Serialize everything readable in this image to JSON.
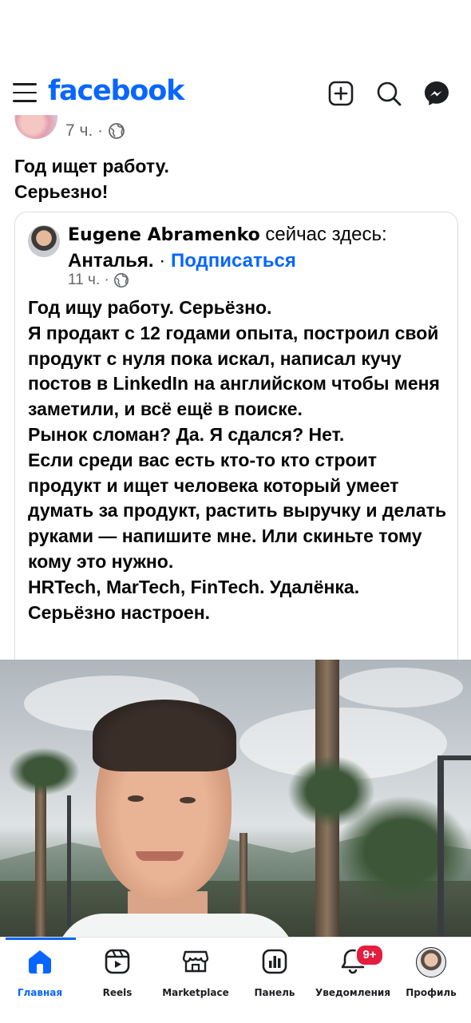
{
  "header": {
    "logo": "facebook",
    "icons": [
      "menu-icon",
      "add-icon",
      "search-icon",
      "messenger-icon"
    ],
    "brand_color": "#0866ff"
  },
  "post": {
    "time": "7 ч. ·",
    "text_lines": [
      "Год ищет работу.",
      "Серьезно!"
    ]
  },
  "shared": {
    "author": "Eugene Abramenko",
    "status_text": "сейчас здесь:",
    "place": "Анталья.",
    "separator": "·",
    "follow_label": "Подписаться",
    "time": "11 ч. ·",
    "paragraphs": [
      "Год ищу работу. Серьёзно.",
      "Я продакт с 12 годами опыта, построил свой продукт с нуля пока искал, написал кучу постов в LinkedIn на английском чтобы меня заметили, и всё ещё в поиске.",
      "Рынок сломан? Да. Я сдался? Нет.",
      "Если среди вас есть кто-то кто строит продукт и ищет человека который умеет думать за продукт, растить выручку и делать руками — напишите мне. Или скиньте тому кому это нужно.",
      "HRTech, MarTech, FinTech. Удалёнка.",
      "Серьёзно настроен."
    ]
  },
  "bottom_nav": {
    "items": [
      {
        "label": "Главная",
        "icon": "home-icon",
        "active": true
      },
      {
        "label": "Reels",
        "icon": "reels-icon"
      },
      {
        "label": "Marketplace",
        "icon": "marketplace-icon"
      },
      {
        "label": "Панель",
        "icon": "dashboard-icon"
      },
      {
        "label": "Уведомления",
        "icon": "bell-icon",
        "badge": "9+"
      },
      {
        "label": "Профиль",
        "icon": "profile-avatar"
      }
    ]
  }
}
